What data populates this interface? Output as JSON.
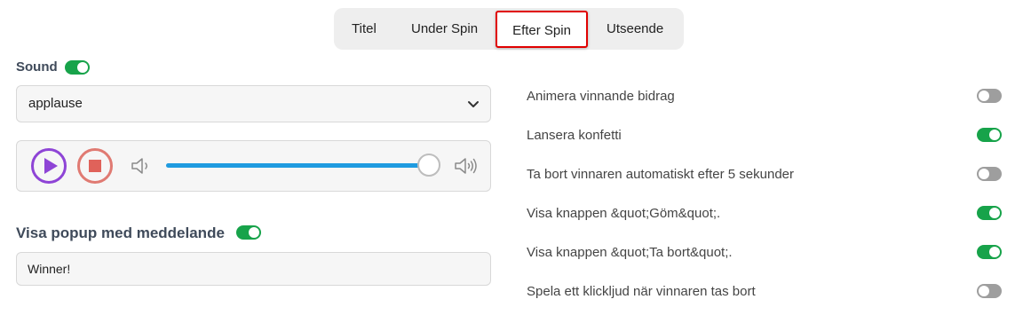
{
  "tabs": [
    {
      "label": "Titel",
      "active": false
    },
    {
      "label": "Under Spin",
      "active": false
    },
    {
      "label": "Efter Spin",
      "active": true
    },
    {
      "label": "Utseende",
      "active": false
    }
  ],
  "sound": {
    "label": "Sound",
    "enabled": true,
    "selected": "applause",
    "volume": 1.0
  },
  "popup": {
    "label": "Visa popup med meddelande",
    "enabled": true,
    "message": "Winner!"
  },
  "options": [
    {
      "label": "Animera vinnande bidrag",
      "enabled": false
    },
    {
      "label": "Lansera konfetti",
      "enabled": true
    },
    {
      "label": "Ta bort vinnaren automatiskt efter 5 sekunder",
      "enabled": false
    },
    {
      "label": "Visa knappen &quot;Göm&quot;.",
      "enabled": true
    },
    {
      "label": "Visa knappen &quot;Ta bort&quot;.",
      "enabled": true
    },
    {
      "label": "Spela ett klickljud när vinnaren tas bort",
      "enabled": false
    }
  ],
  "colors": {
    "toggle_on": "#17a34a",
    "toggle_off": "#9e9e9e",
    "play": "#8e44d6",
    "stop": "#e0625a",
    "volume_fill": "#1f9be0",
    "active_tab_border": "#e00000"
  },
  "icons": {
    "play": "play-icon",
    "stop": "stop-icon",
    "volume_low": "volume-low-icon",
    "volume_high": "volume-high-icon",
    "chevron": "chevron-down-icon"
  }
}
